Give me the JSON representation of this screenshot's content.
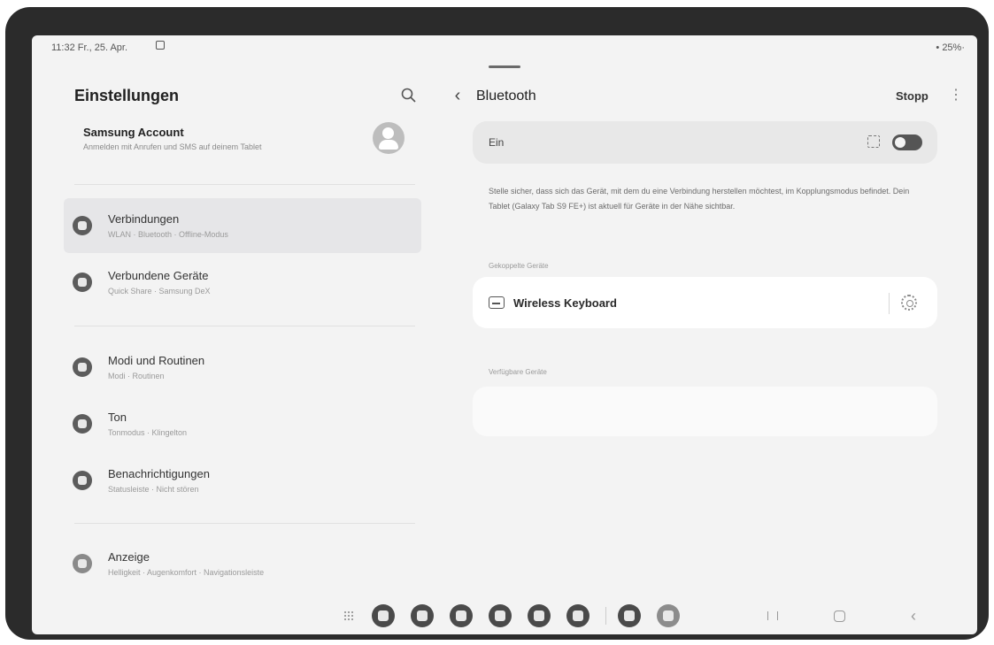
{
  "status_bar": {
    "time": "11:32 Fr., 25. Apr.",
    "battery": "• 25%·"
  },
  "left_pane": {
    "title": "Einstellungen",
    "account": {
      "title": "Samsung Account",
      "subtitle": "Anmelden mit Anrufen und SMS auf deinem Tablet"
    },
    "items": [
      {
        "label": "Verbindungen",
        "subtitle": "WLAN · Bluetooth · Offline-Modus",
        "icon": "wifi-icon",
        "active": true
      },
      {
        "label": "Verbundene Geräte",
        "subtitle": "Quick Share · Samsung DeX",
        "icon": "devices-icon",
        "active": false
      },
      {
        "label": "Modi und Routinen",
        "subtitle": "Modi · Routinen",
        "icon": "routines-icon",
        "active": false
      },
      {
        "label": "Ton",
        "subtitle": "Tonmodus · Klingelton",
        "icon": "sound-icon",
        "active": false
      },
      {
        "label": "Benachrichtigungen",
        "subtitle": "Statusleiste · Nicht stören",
        "icon": "notifications-icon",
        "active": false
      },
      {
        "label": "Anzeige",
        "subtitle": "Helligkeit · Augenkomfort · Navigationsleiste",
        "icon": "display-icon",
        "active": false
      }
    ]
  },
  "right_pane": {
    "title": "Bluetooth",
    "stop_label": "Stopp",
    "toggle_label": "Ein",
    "toggle_on": true,
    "info_text": "Stelle sicher, dass sich das Gerät, mit dem du eine Verbindung herstellen möchtest, im Kopplungsmodus befindet. Dein Tablet (Galaxy Tab S9 FE+) ist aktuell für Geräte in der Nähe sichtbar.",
    "paired_label": "Gekoppelte Geräte",
    "paired_devices": [
      {
        "name": "Wireless Keyboard",
        "icon": "keyboard-icon"
      }
    ],
    "available_label": "Verfügbare Geräte"
  },
  "taskbar": {
    "apps": [
      "app-1",
      "app-2",
      "app-3",
      "app-4",
      "app-5",
      "app-6",
      "app-7",
      "app-8"
    ]
  }
}
